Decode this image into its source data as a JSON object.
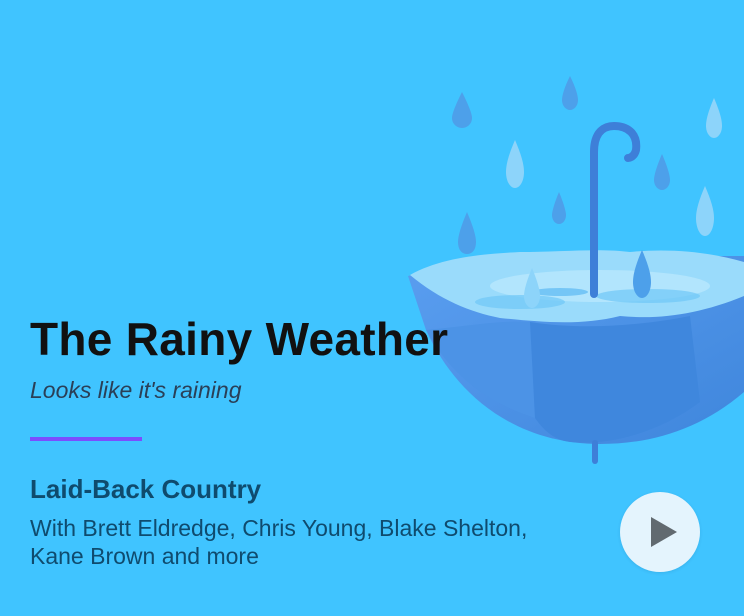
{
  "card": {
    "title": "The Rainy Weather",
    "subtitle": "Looks like it's raining"
  },
  "playlist": {
    "name": "Laid-Back Country",
    "description": "With Brett Eldredge, Chris Young, Blake Shelton, Kane Brown and more"
  },
  "icons": {
    "illustration": "umbrella-rain-illustration",
    "play": "play-icon"
  },
  "colors": {
    "background": "#40c4ff",
    "accent": "#7c4dff",
    "umbrella": "#4a8fe0",
    "play_button": "#e4f4fd"
  }
}
